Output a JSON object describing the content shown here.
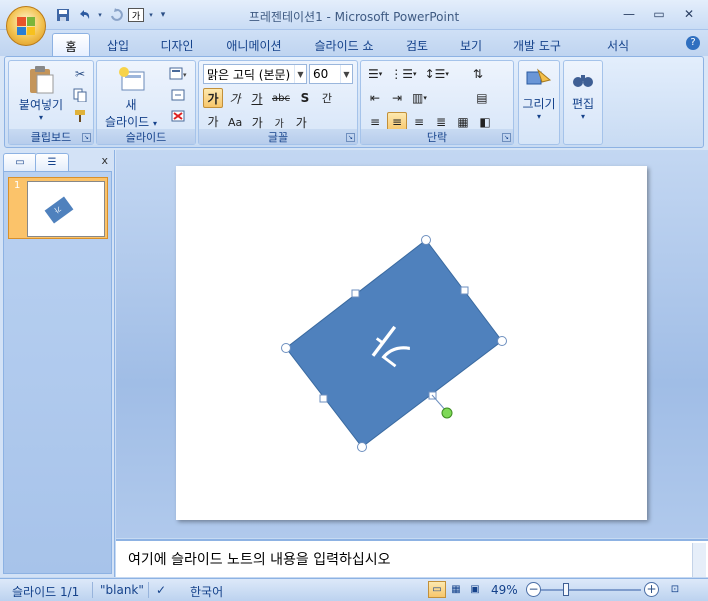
{
  "window": {
    "title": "프레젠테이션1 - Microsoft PowerPoint",
    "controls": [
      "—",
      "▭",
      "✕"
    ]
  },
  "qat": {
    "save": "save-icon",
    "undo": "undo-icon",
    "redo": "redo-icon",
    "format_glyph": "가",
    "customize": "▾"
  },
  "tabs": [
    "홈",
    "삽입",
    "디자인",
    "애니메이션",
    "슬라이드 쇼",
    "검토",
    "보기",
    "개발 도구",
    "서식"
  ],
  "active_tab": "홈",
  "help": "?",
  "ribbon": {
    "clipboard": {
      "paste": "붙여넣기",
      "label": "클립보드"
    },
    "slides": {
      "new_slide_1": "새",
      "new_slide_2": "슬라이드",
      "label": "슬라이드"
    },
    "font": {
      "font_name": "맑은 고딕 (본문)",
      "font_size": "60",
      "bold": "가",
      "italic": "가",
      "underline": "가",
      "strike": "abc",
      "shadow": "S",
      "spacing": "간",
      "color": "가",
      "case": "Aa",
      "grow": "가",
      "shrink": "가",
      "clear": "가",
      "label": "글꼴"
    },
    "paragraph": {
      "label": "단락"
    },
    "drawing": {
      "label": "그리기"
    },
    "editing": {
      "label": "편집"
    }
  },
  "left_pane": {
    "slide_number": "1",
    "close": "x",
    "thumb_text": "가"
  },
  "slide": {
    "shape_text": "가",
    "fill": "#4f81bd",
    "rotation_deg": 180
  },
  "notes": {
    "placeholder": "여기에 슬라이드 노트의 내용을 입력하십시오"
  },
  "status": {
    "slide_info": "슬라이드 1/1",
    "theme": "\"blank\"",
    "language": "한국어",
    "zoom": "49%",
    "zoom_min": "−",
    "zoom_plus": "+"
  }
}
